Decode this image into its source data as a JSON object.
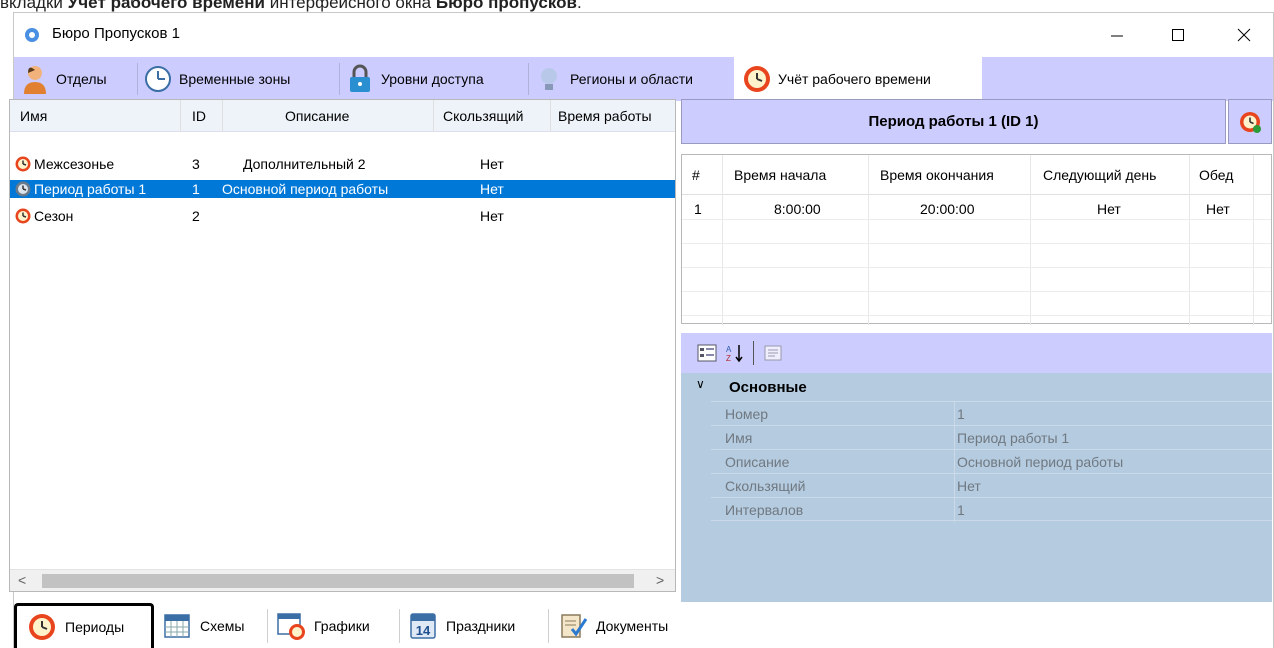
{
  "caption": {
    "prefix": "вкладки ",
    "tab_name": "Учёт рабочего времени",
    "middle": " интерфейсного окна ",
    "window_name": "Бюро пропусков",
    "suffix": "."
  },
  "window": {
    "title": "Бюро Пропусков 1",
    "controls": {
      "minimize": "—",
      "maximize": "☐",
      "close": "✕"
    }
  },
  "top_tabs": [
    {
      "label": "Отделы",
      "icon": "person-icon"
    },
    {
      "label": "Временные зоны",
      "icon": "clock-icon"
    },
    {
      "label": "Уровни доступа",
      "icon": "lock-icon"
    },
    {
      "label": "Регионы и области",
      "icon": "lightbulb-icon"
    },
    {
      "label": "Учёт рабочего времени",
      "icon": "work-time-icon",
      "active": true
    }
  ],
  "periods_list": {
    "columns": [
      "Имя",
      "ID",
      "Описание",
      "Скользящий",
      "Время работы"
    ],
    "rows": [
      {
        "name": "Межсезонье",
        "id": "3",
        "description": "Дополнительный 2",
        "sliding": "Нет",
        "selected": false
      },
      {
        "name": "Период работы 1",
        "id": "1",
        "description": "Основной период работы",
        "sliding": "Нет",
        "selected": true
      },
      {
        "name": "Сезон",
        "id": "2",
        "description": "",
        "sliding": "Нет",
        "selected": false
      }
    ],
    "scroll_left": "<",
    "scroll_right": ">"
  },
  "detail": {
    "header": "Период работы 1 (ID 1)",
    "table": {
      "columns": [
        "#",
        "Время начала",
        "Время окончания",
        "Следующий день",
        "Обед"
      ],
      "rows": [
        {
          "num": "1",
          "start": "8:00:00",
          "end": "20:00:00",
          "next_day": "Нет",
          "lunch": "Нет"
        }
      ]
    },
    "properties": {
      "category": "Основные",
      "items": [
        {
          "key": "Номер",
          "value": "1"
        },
        {
          "key": "Имя",
          "value": "Период работы 1"
        },
        {
          "key": "Описание",
          "value": "Основной период работы"
        },
        {
          "key": "Скользящий",
          "value": "Нет"
        },
        {
          "key": "Интервалов",
          "value": "1"
        }
      ]
    }
  },
  "bottom_tabs": [
    {
      "label": "Периоды",
      "icon": "period-clock-icon",
      "active": true
    },
    {
      "label": "Схемы",
      "icon": "calendar-grid-icon"
    },
    {
      "label": "Графики",
      "icon": "schedule-icon"
    },
    {
      "label": "Праздники",
      "icon": "calendar-14-icon"
    },
    {
      "label": "Документы",
      "icon": "document-check-icon"
    }
  ],
  "colors": {
    "tab_strip": "#ccccff",
    "selection": "#0078d7",
    "property_grid": "#b4cbe0",
    "clock_orange": "#e8451e"
  }
}
